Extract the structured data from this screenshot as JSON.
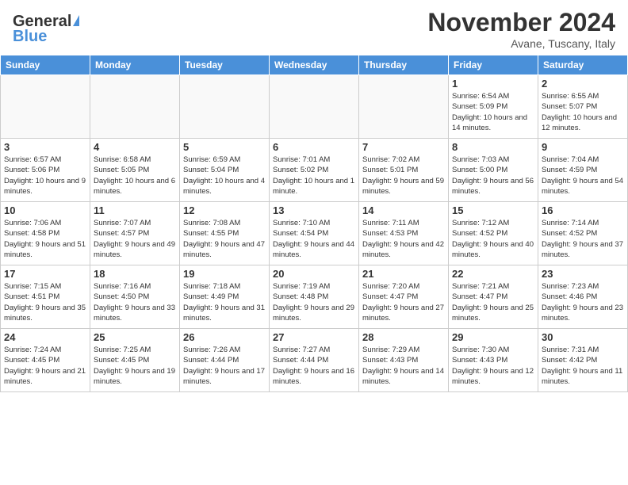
{
  "header": {
    "logo_general": "General",
    "logo_blue": "Blue",
    "month_title": "November 2024",
    "location": "Avane, Tuscany, Italy"
  },
  "days_of_week": [
    "Sunday",
    "Monday",
    "Tuesday",
    "Wednesday",
    "Thursday",
    "Friday",
    "Saturday"
  ],
  "weeks": [
    [
      {
        "day": "",
        "info": ""
      },
      {
        "day": "",
        "info": ""
      },
      {
        "day": "",
        "info": ""
      },
      {
        "day": "",
        "info": ""
      },
      {
        "day": "",
        "info": ""
      },
      {
        "day": "1",
        "info": "Sunrise: 6:54 AM\nSunset: 5:09 PM\nDaylight: 10 hours and 14 minutes."
      },
      {
        "day": "2",
        "info": "Sunrise: 6:55 AM\nSunset: 5:07 PM\nDaylight: 10 hours and 12 minutes."
      }
    ],
    [
      {
        "day": "3",
        "info": "Sunrise: 6:57 AM\nSunset: 5:06 PM\nDaylight: 10 hours and 9 minutes."
      },
      {
        "day": "4",
        "info": "Sunrise: 6:58 AM\nSunset: 5:05 PM\nDaylight: 10 hours and 6 minutes."
      },
      {
        "day": "5",
        "info": "Sunrise: 6:59 AM\nSunset: 5:04 PM\nDaylight: 10 hours and 4 minutes."
      },
      {
        "day": "6",
        "info": "Sunrise: 7:01 AM\nSunset: 5:02 PM\nDaylight: 10 hours and 1 minute."
      },
      {
        "day": "7",
        "info": "Sunrise: 7:02 AM\nSunset: 5:01 PM\nDaylight: 9 hours and 59 minutes."
      },
      {
        "day": "8",
        "info": "Sunrise: 7:03 AM\nSunset: 5:00 PM\nDaylight: 9 hours and 56 minutes."
      },
      {
        "day": "9",
        "info": "Sunrise: 7:04 AM\nSunset: 4:59 PM\nDaylight: 9 hours and 54 minutes."
      }
    ],
    [
      {
        "day": "10",
        "info": "Sunrise: 7:06 AM\nSunset: 4:58 PM\nDaylight: 9 hours and 51 minutes."
      },
      {
        "day": "11",
        "info": "Sunrise: 7:07 AM\nSunset: 4:57 PM\nDaylight: 9 hours and 49 minutes."
      },
      {
        "day": "12",
        "info": "Sunrise: 7:08 AM\nSunset: 4:55 PM\nDaylight: 9 hours and 47 minutes."
      },
      {
        "day": "13",
        "info": "Sunrise: 7:10 AM\nSunset: 4:54 PM\nDaylight: 9 hours and 44 minutes."
      },
      {
        "day": "14",
        "info": "Sunrise: 7:11 AM\nSunset: 4:53 PM\nDaylight: 9 hours and 42 minutes."
      },
      {
        "day": "15",
        "info": "Sunrise: 7:12 AM\nSunset: 4:52 PM\nDaylight: 9 hours and 40 minutes."
      },
      {
        "day": "16",
        "info": "Sunrise: 7:14 AM\nSunset: 4:52 PM\nDaylight: 9 hours and 37 minutes."
      }
    ],
    [
      {
        "day": "17",
        "info": "Sunrise: 7:15 AM\nSunset: 4:51 PM\nDaylight: 9 hours and 35 minutes."
      },
      {
        "day": "18",
        "info": "Sunrise: 7:16 AM\nSunset: 4:50 PM\nDaylight: 9 hours and 33 minutes."
      },
      {
        "day": "19",
        "info": "Sunrise: 7:18 AM\nSunset: 4:49 PM\nDaylight: 9 hours and 31 minutes."
      },
      {
        "day": "20",
        "info": "Sunrise: 7:19 AM\nSunset: 4:48 PM\nDaylight: 9 hours and 29 minutes."
      },
      {
        "day": "21",
        "info": "Sunrise: 7:20 AM\nSunset: 4:47 PM\nDaylight: 9 hours and 27 minutes."
      },
      {
        "day": "22",
        "info": "Sunrise: 7:21 AM\nSunset: 4:47 PM\nDaylight: 9 hours and 25 minutes."
      },
      {
        "day": "23",
        "info": "Sunrise: 7:23 AM\nSunset: 4:46 PM\nDaylight: 9 hours and 23 minutes."
      }
    ],
    [
      {
        "day": "24",
        "info": "Sunrise: 7:24 AM\nSunset: 4:45 PM\nDaylight: 9 hours and 21 minutes."
      },
      {
        "day": "25",
        "info": "Sunrise: 7:25 AM\nSunset: 4:45 PM\nDaylight: 9 hours and 19 minutes."
      },
      {
        "day": "26",
        "info": "Sunrise: 7:26 AM\nSunset: 4:44 PM\nDaylight: 9 hours and 17 minutes."
      },
      {
        "day": "27",
        "info": "Sunrise: 7:27 AM\nSunset: 4:44 PM\nDaylight: 9 hours and 16 minutes."
      },
      {
        "day": "28",
        "info": "Sunrise: 7:29 AM\nSunset: 4:43 PM\nDaylight: 9 hours and 14 minutes."
      },
      {
        "day": "29",
        "info": "Sunrise: 7:30 AM\nSunset: 4:43 PM\nDaylight: 9 hours and 12 minutes."
      },
      {
        "day": "30",
        "info": "Sunrise: 7:31 AM\nSunset: 4:42 PM\nDaylight: 9 hours and 11 minutes."
      }
    ]
  ]
}
